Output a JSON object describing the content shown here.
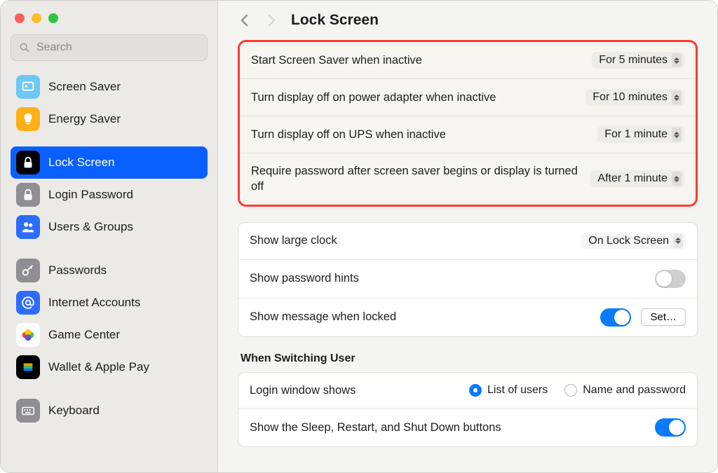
{
  "search": {
    "placeholder": "Search"
  },
  "sidebar": {
    "items": [
      {
        "label": "Screen Saver",
        "icon": "screen-saver-icon",
        "bg": "#6dc8f4"
      },
      {
        "label": "Energy Saver",
        "icon": "bulb-icon",
        "bg": "#ffb016"
      },
      {
        "label": "Lock Screen",
        "icon": "lock-icon",
        "bg": "#000000",
        "selected": true
      },
      {
        "label": "Login Password",
        "icon": "lock-open-icon",
        "bg": "#8e8e93"
      },
      {
        "label": "Users & Groups",
        "icon": "users-icon",
        "bg": "#2e6cff"
      },
      {
        "label": "Passwords",
        "icon": "key-icon",
        "bg": "#8e8e93"
      },
      {
        "label": "Internet Accounts",
        "icon": "at-icon",
        "bg": "#2e6cff"
      },
      {
        "label": "Game Center",
        "icon": "game-icon",
        "bg": "#ffffff"
      },
      {
        "label": "Wallet & Apple Pay",
        "icon": "wallet-icon",
        "bg": "#000000"
      },
      {
        "label": "Keyboard",
        "icon": "keyboard-icon",
        "bg": "#8e8e93"
      }
    ],
    "gaps_after": [
      1,
      4,
      8
    ]
  },
  "header": {
    "title": "Lock Screen"
  },
  "highlight_group": [
    {
      "label": "Start Screen Saver when inactive",
      "value": "For 5 minutes"
    },
    {
      "label": "Turn display off on power adapter when inactive",
      "value": "For 10 minutes"
    },
    {
      "label": "Turn display off on UPS when inactive",
      "value": "For 1 minute"
    },
    {
      "label": "Require password after screen saver begins or display is turned off",
      "value": "After 1 minute"
    }
  ],
  "group2": {
    "large_clock": {
      "label": "Show large clock",
      "value": "On Lock Screen"
    },
    "password_hints": {
      "label": "Show password hints",
      "toggle": false
    },
    "message_locked": {
      "label": "Show message when locked",
      "toggle": true,
      "button": "Set…"
    }
  },
  "switching": {
    "heading": "When Switching User",
    "login_window": {
      "label": "Login window shows",
      "option1": "List of users",
      "option2": "Name and password",
      "selected": "option1"
    },
    "sleep_restart": {
      "label": "Show the Sleep, Restart, and Shut Down buttons",
      "toggle": true
    }
  }
}
